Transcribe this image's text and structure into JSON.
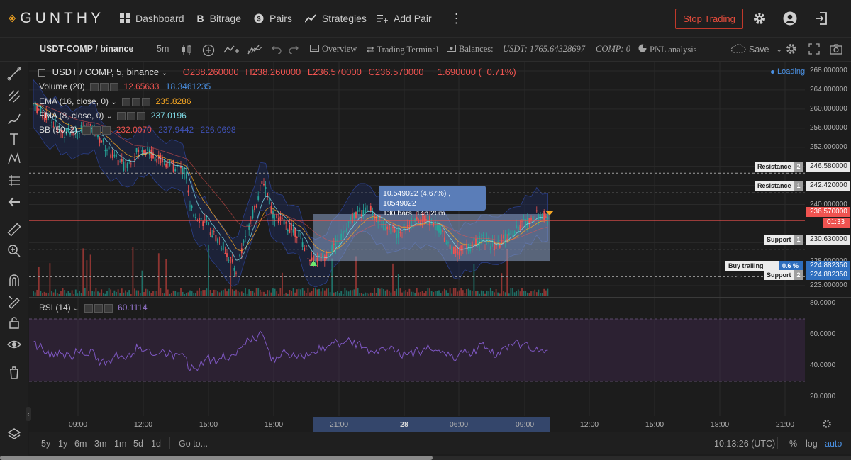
{
  "nav": {
    "brand": "GUNTHY",
    "items": [
      {
        "label": "Dashboard",
        "icon": "dashboard-icon"
      },
      {
        "label": "Bitrage",
        "icon": "bitrage-icon"
      },
      {
        "label": "Pairs",
        "icon": "pairs-icon"
      },
      {
        "label": "Strategies",
        "icon": "strategies-icon"
      },
      {
        "label": "Add Pair",
        "icon": "add-pair-icon"
      }
    ],
    "stop_button": "Stop Trading"
  },
  "toolbar": {
    "symbol": "USDT-COMP / binance",
    "interval": "5m",
    "overview": "Overview",
    "trading_terminal": "Trading Terminal",
    "balances_label": "Balances:",
    "balance_usdt": "USDT: 1765.64328697",
    "balance_comp": "COMP: 0",
    "pnl": "PNL analysis",
    "save": "Save"
  },
  "legend": {
    "main_title": "USDT / COMP, 5, binance",
    "O": "O238.260000",
    "H": "H238.260000",
    "L": "L236.570000",
    "C": "C236.570000",
    "change": "−1.690000 (−0.71%)",
    "loading": "Loading",
    "volume_label": "Volume (20)",
    "volume_v1": "12.65633",
    "volume_v2": "18.3461235",
    "ema16_label": "EMA (16, close, 0)",
    "ema16_value": "235.8286",
    "ema8_label": "EMA (8, close, 0)",
    "ema8_value": "237.0196",
    "bb_label": "BB (50, 2)",
    "bb_v1": "232.0070",
    "bb_v2": "237.9442",
    "bb_v3": "226.0698",
    "rsi_label": "RSI (14)",
    "rsi_value": "60.1114"
  },
  "measure": {
    "line1": "10.549022 (4.67%) , 10549022",
    "line2": "130 bars, 14h 20m"
  },
  "price_axis": [
    "268.000000",
    "264.000000",
    "260.000000",
    "256.000000",
    "252.000000",
    "248.000000",
    "244.000000",
    "240.000000",
    "232.000000",
    "228.000000",
    "223.000000"
  ],
  "rsi_axis": [
    "80.0000",
    "60.0000",
    "40.0000",
    "20.0000"
  ],
  "levels": {
    "resistance": "Resistance",
    "support": "Support",
    "buy_trailing": "Buy trailing stop",
    "buy_trailing_pct": "0.6 %",
    "r2_num": "2",
    "r2_price": "246.580000",
    "r1_num": "1",
    "r1_price": "242.420000",
    "s1_num": "1",
    "s1_price": "230.630000",
    "s2_num": "2",
    "s2_price": "224.882350",
    "buy_price": "224.882350",
    "last_price": "236.570000",
    "countdown": "01:33"
  },
  "time_axis": [
    "09:00",
    "12:00",
    "15:00",
    "18:00",
    "21:00",
    "28",
    "06:00",
    "09:00",
    "12:00",
    "15:00",
    "18:00",
    "21:00"
  ],
  "bottom": {
    "ranges": [
      "5y",
      "1y",
      "6m",
      "3m",
      "1m",
      "5d",
      "1d"
    ],
    "goto": "Go to...",
    "clock": "10:13:26 (UTC)",
    "percent": "%",
    "log": "log",
    "auto": "auto"
  },
  "colors": {
    "up": "#26a69a",
    "down": "#ef5350",
    "accent": "#2962ff",
    "stop": "#e74c3c",
    "rsi": "#7e57c2"
  }
}
